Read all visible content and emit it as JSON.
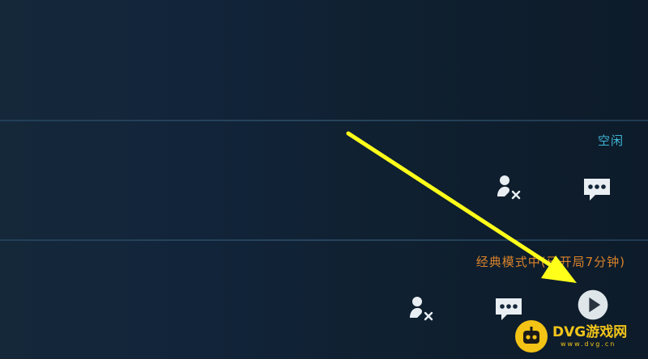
{
  "rows": [
    {
      "status": "空闲",
      "status_color": "#3fb7d6",
      "actions": [
        "unfriend-icon",
        "chat-icon"
      ]
    },
    {
      "status": "经典模式中(已开局7分钟)",
      "status_color": "#d9822b",
      "actions": [
        "unfriend-icon",
        "chat-icon",
        "spectate-play-icon"
      ]
    }
  ],
  "annotation": {
    "arrow_color": "#ffff1a",
    "arrow_target": "spectate-play-icon"
  },
  "watermark": {
    "title": "DVG游戏网",
    "subtitle": "www.dvg.cn",
    "color": "#f2c51a"
  }
}
